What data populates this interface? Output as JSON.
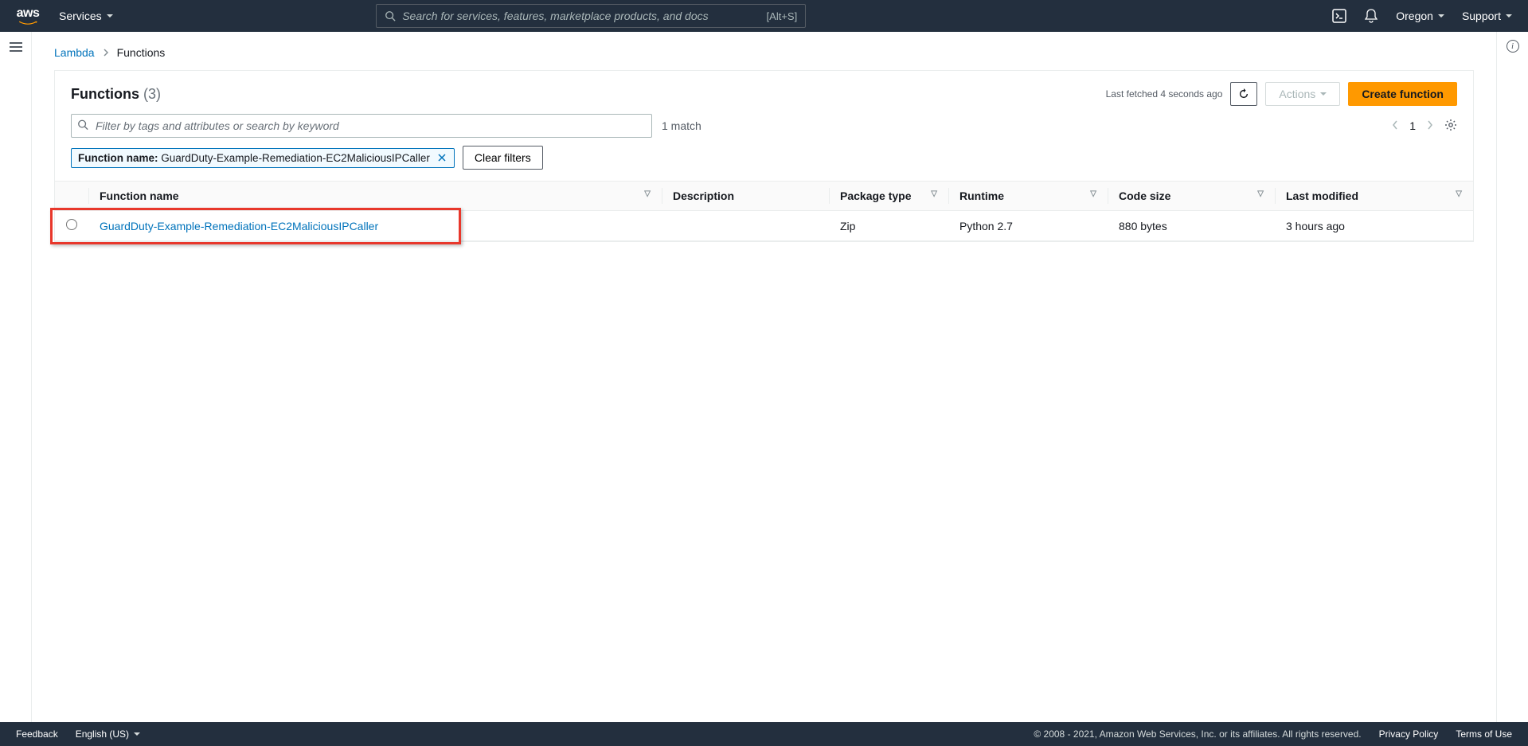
{
  "topnav": {
    "services_label": "Services",
    "search_placeholder": "Search for services, features, marketplace products, and docs",
    "search_shortcut": "[Alt+S]",
    "region": "Oregon",
    "support": "Support"
  },
  "breadcrumb": {
    "root": "Lambda",
    "current": "Functions"
  },
  "header": {
    "title": "Functions",
    "count": "(3)",
    "last_fetched": "Last fetched 4 seconds ago",
    "actions_label": "Actions",
    "create_label": "Create function"
  },
  "toolbar": {
    "filter_placeholder": "Filter by tags and attributes or search by keyword",
    "match_text": "1 match",
    "page": "1"
  },
  "chip": {
    "label": "Function name:",
    "value": "GuardDuty-Example-Remediation-EC2MaliciousIPCaller"
  },
  "clear_filters": "Clear filters",
  "columns": {
    "c1": "Function name",
    "c2": "Description",
    "c3": "Package type",
    "c4": "Runtime",
    "c5": "Code size",
    "c6": "Last modified"
  },
  "rows": [
    {
      "name": "GuardDuty-Example-Remediation-EC2MaliciousIPCaller",
      "description": "",
      "package_type": "Zip",
      "runtime": "Python 2.7",
      "code_size": "880 bytes",
      "last_modified": "3 hours ago"
    }
  ],
  "footer": {
    "feedback": "Feedback",
    "language": "English (US)",
    "copyright": "© 2008 - 2021, Amazon Web Services, Inc. or its affiliates. All rights reserved.",
    "privacy": "Privacy Policy",
    "terms": "Terms of Use"
  }
}
